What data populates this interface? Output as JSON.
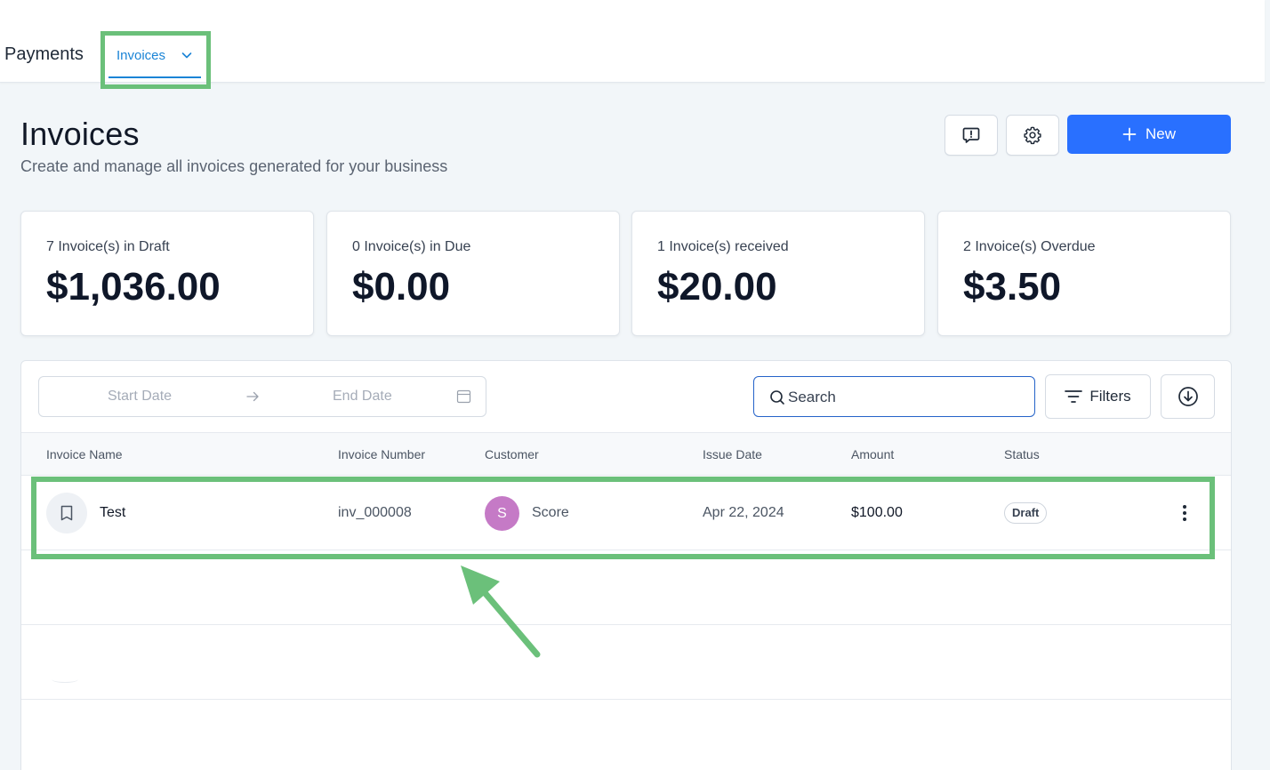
{
  "nav": {
    "title": "Payments",
    "active_tab": "Invoices"
  },
  "header": {
    "title": "Invoices",
    "subtitle": "Create and manage all invoices generated for your business",
    "new_button": "New",
    "icons": [
      "feedback-icon",
      "settings-icon",
      "plus-icon"
    ]
  },
  "stats": [
    {
      "label": "7 Invoice(s) in Draft",
      "value": "$1,036.00"
    },
    {
      "label": "0 Invoice(s) in Due",
      "value": "$0.00"
    },
    {
      "label": "1 Invoice(s) received",
      "value": "$20.00"
    },
    {
      "label": "2 Invoice(s) Overdue",
      "value": "$3.50"
    }
  ],
  "toolbar": {
    "start_date_placeholder": "Start Date",
    "end_date_placeholder": "End Date",
    "search_placeholder": "Search",
    "filters_label": "Filters"
  },
  "table": {
    "columns": [
      "Invoice Name",
      "Invoice Number",
      "Customer",
      "Issue Date",
      "Amount",
      "Status"
    ],
    "rows": [
      {
        "name": "Test",
        "number": "inv_000008",
        "customer_initial": "S",
        "customer": "Score",
        "issue_date": "Apr 22, 2024",
        "amount": "$100.00",
        "status": "Draft"
      }
    ]
  },
  "colors": {
    "primary": "#2970ff",
    "tab_accent": "#1b84d6",
    "annotation": "#6bc07a",
    "avatar": "#c57ac6"
  }
}
